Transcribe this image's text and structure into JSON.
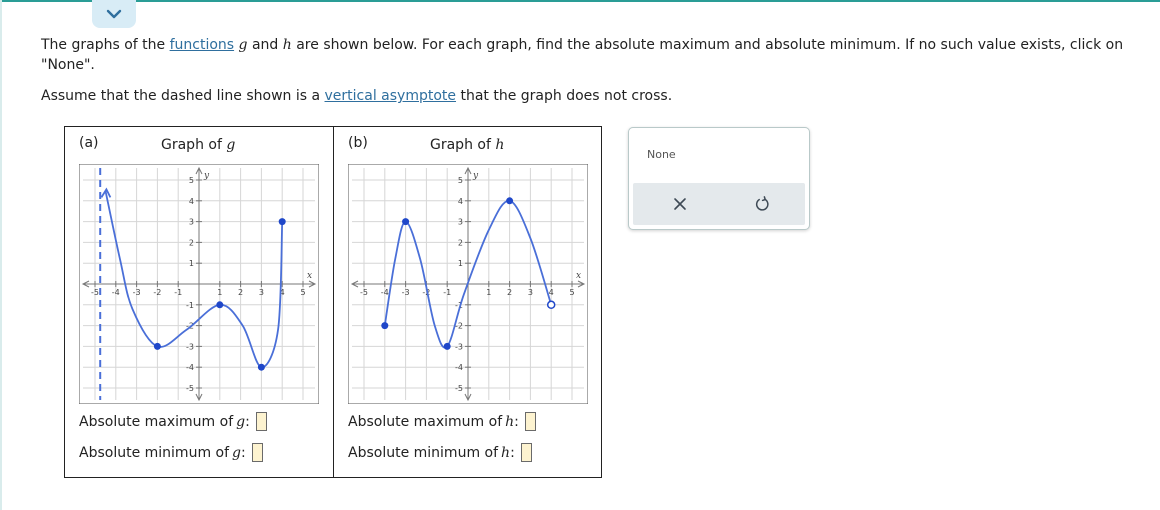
{
  "intro": {
    "part1": "The graphs of the ",
    "link": "functions",
    "part2": " and ",
    "part3": " are shown below. For each graph, find the absolute maximum and absolute minimum. If no such value exists, click on \"None\".",
    "var_g": "g",
    "var_h": "h"
  },
  "assume": {
    "part1": "Assume that the dashed line shown is a ",
    "link": "vertical asymptote",
    "part2": " that the graph does not cross."
  },
  "panel_a": {
    "tag": "(a)",
    "title_prefix": "Graph of ",
    "title_var": "g",
    "max_label": "Absolute maximum of ",
    "min_label": "Absolute minimum of ",
    "var": "g",
    "colon": ":"
  },
  "panel_b": {
    "tag": "(b)",
    "title_prefix": "Graph of ",
    "title_var": "h",
    "max_label": "Absolute maximum of ",
    "min_label": "Absolute minimum of ",
    "var": "h",
    "colon": ":"
  },
  "axis_labels": {
    "x": "x",
    "y": "y"
  },
  "ticks": {
    "x_neg": [
      "-5",
      "-4",
      "-3",
      "-2",
      "-1"
    ],
    "x_pos": [
      "1",
      "2",
      "3",
      "4",
      "5"
    ],
    "y_pos": [
      "1",
      "2",
      "3",
      "4",
      "5"
    ],
    "y_neg": [
      "-1",
      "-2",
      "-3",
      "-4",
      "-5"
    ]
  },
  "none_panel": {
    "label": "None"
  },
  "colors": {
    "curve": "#4a6fd8",
    "accent": "#2a9d96",
    "link": "#2f6f9e",
    "answer_box": "#fdf3d0"
  },
  "chart_data": [
    {
      "type": "line",
      "name_in_image": "Graph of g",
      "xlim": [
        -5,
        5
      ],
      "ylim": [
        -5,
        5
      ],
      "vertical_asymptote_x": -4.75,
      "key_points": [
        {
          "x": -4.5,
          "y": 4.5,
          "marker": "arrow"
        },
        {
          "x": -2,
          "y": -3,
          "marker": "closed"
        },
        {
          "x": 1,
          "y": -1,
          "marker": "closed"
        },
        {
          "x": 3,
          "y": -4,
          "marker": "closed"
        },
        {
          "x": 4,
          "y": 3,
          "marker": "closed"
        }
      ]
    },
    {
      "type": "line",
      "name_in_image": "Graph of h",
      "xlim": [
        -5,
        5
      ],
      "ylim": [
        -5,
        5
      ],
      "key_points": [
        {
          "x": -4,
          "y": -2,
          "marker": "closed"
        },
        {
          "x": -3,
          "y": 3,
          "marker": "closed"
        },
        {
          "x": -1,
          "y": -3,
          "marker": "closed"
        },
        {
          "x": 2,
          "y": 4,
          "marker": "closed"
        },
        {
          "x": 4,
          "y": -1,
          "marker": "open"
        }
      ]
    }
  ]
}
